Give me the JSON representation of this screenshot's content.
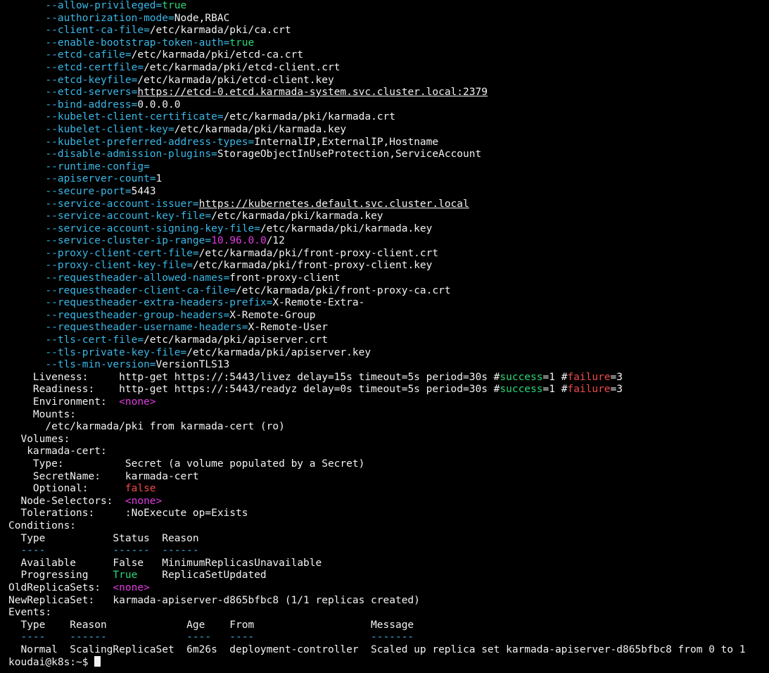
{
  "terminal": {
    "flags": [
      {
        "name": "--allow-privileged",
        "eq": "=",
        "value": "true",
        "style": "green"
      },
      {
        "name": "--authorization-mode",
        "eq": "=",
        "value": "Node,RBAC",
        "style": ""
      },
      {
        "name": "--client-ca-file",
        "eq": "=",
        "value": "/etc/karmada/pki/ca.crt",
        "style": ""
      },
      {
        "name": "--enable-bootstrap-token-auth",
        "eq": "=",
        "value": "true",
        "style": "green"
      },
      {
        "name": "--etcd-cafile",
        "eq": "=",
        "value": "/etc/karmada/pki/etcd-ca.crt",
        "style": ""
      },
      {
        "name": "--etcd-certfile",
        "eq": "=",
        "value": "/etc/karmada/pki/etcd-client.crt",
        "style": ""
      },
      {
        "name": "--etcd-keyfile",
        "eq": "=",
        "value": "/etc/karmada/pki/etcd-client.key",
        "style": ""
      },
      {
        "name": "--etcd-servers",
        "eq": "=",
        "value": "https://etcd-0.etcd.karmada-system.svc.cluster.local:2379",
        "style": "url"
      },
      {
        "name": "--bind-address",
        "eq": "=",
        "value": "0.0.0.0",
        "style": ""
      },
      {
        "name": "--kubelet-client-certificate",
        "eq": "=",
        "value": "/etc/karmada/pki/karmada.crt",
        "style": ""
      },
      {
        "name": "--kubelet-client-key",
        "eq": "=",
        "value": "/etc/karmada/pki/karmada.key",
        "style": ""
      },
      {
        "name": "--kubelet-preferred-address-types",
        "eq": "=",
        "value": "InternalIP,ExternalIP,Hostname",
        "style": ""
      },
      {
        "name": "--disable-admission-plugins",
        "eq": "=",
        "value": "StorageObjectInUseProtection,ServiceAccount",
        "style": ""
      },
      {
        "name": "--runtime-config",
        "eq": "=",
        "value": "",
        "style": ""
      },
      {
        "name": "--apiserver-count",
        "eq": "=",
        "value": "1",
        "style": ""
      },
      {
        "name": "--secure-port",
        "eq": "=",
        "value": "5443",
        "style": ""
      },
      {
        "name": "--service-account-issuer",
        "eq": "=",
        "value": "https://kubernetes.default.svc.cluster.local",
        "style": "url"
      },
      {
        "name": "--service-account-key-file",
        "eq": "=",
        "value": "/etc/karmada/pki/karmada.key",
        "style": ""
      },
      {
        "name": "--service-account-signing-key-file",
        "eq": "=",
        "value": "/etc/karmada/pki/karmada.key",
        "style": ""
      },
      {
        "name": "--service-cluster-ip-range",
        "eq": "=",
        "value": "10.96.0.0",
        "value2": "/12",
        "style": "magenta-ip"
      },
      {
        "name": "--proxy-client-cert-file",
        "eq": "=",
        "value": "/etc/karmada/pki/front-proxy-client.crt",
        "style": ""
      },
      {
        "name": "--proxy-client-key-file",
        "eq": "=",
        "value": "/etc/karmada/pki/front-proxy-client.key",
        "style": ""
      },
      {
        "name": "--requestheader-allowed-names",
        "eq": "=",
        "value": "front-proxy-client",
        "style": ""
      },
      {
        "name": "--requestheader-client-ca-file",
        "eq": "=",
        "value": "/etc/karmada/pki/front-proxy-ca.crt",
        "style": ""
      },
      {
        "name": "--requestheader-extra-headers-prefix",
        "eq": "=",
        "value": "X-Remote-Extra-",
        "style": ""
      },
      {
        "name": "--requestheader-group-headers",
        "eq": "=",
        "value": "X-Remote-Group",
        "style": ""
      },
      {
        "name": "--requestheader-username-headers",
        "eq": "=",
        "value": "X-Remote-User",
        "style": ""
      },
      {
        "name": "--tls-cert-file",
        "eq": "=",
        "value": "/etc/karmada/pki/apiserver.crt",
        "style": ""
      },
      {
        "name": "--tls-private-key-file",
        "eq": "=",
        "value": "/etc/karmada/pki/apiserver.key",
        "style": ""
      },
      {
        "name": "--tls-min-version",
        "eq": "=",
        "value": "VersionTLS13",
        "style": ""
      }
    ],
    "liveness": {
      "label": "    Liveness:     ",
      "pre": "http-get https://:5443/livez delay=15s timeout=5s period=30s #",
      "success_word": "success",
      "mid": "=1 #",
      "failure_word": "failure",
      "post": "=3"
    },
    "readiness": {
      "label": "    Readiness:    ",
      "pre": "http-get https://:5443/readyz delay=0s timeout=5s period=30s #",
      "success_word": "success",
      "mid": "=1 #",
      "failure_word": "failure",
      "post": "=3"
    },
    "environment": {
      "label": "    Environment:  ",
      "value": "<none>"
    },
    "mounts_label": "    Mounts:",
    "mount_line": "      /etc/karmada/pki from karmada-cert (ro)",
    "volumes_label": "  Volumes:",
    "volume_name": "   karmada-cert:",
    "volume_type": {
      "label": "    Type:          ",
      "value": "Secret (a volume populated by a Secret)"
    },
    "volume_secret": {
      "label": "    SecretName:    ",
      "value": "karmada-cert"
    },
    "volume_optional": {
      "label": "    Optional:      ",
      "value": "false"
    },
    "node_selectors": {
      "label": "  Node-Selectors:  ",
      "value": "<none>"
    },
    "tolerations": {
      "label": "  Tolerations:     ",
      "value": ":NoExecute op=Exists"
    },
    "conditions": {
      "label": "Conditions:",
      "header": "  Type           Status  Reason",
      "separator": "  ----           ------  ------",
      "rows": [
        {
          "type": "  Available      ",
          "status": "False",
          "status_style": "",
          "gap": "   ",
          "reason": "MinimumReplicasUnavailable"
        },
        {
          "type": "  Progressing    ",
          "status": "True",
          "status_style": "green",
          "gap": "    ",
          "reason": "ReplicaSetUpdated"
        }
      ]
    },
    "old_replica_sets": {
      "label": "OldReplicaSets:  ",
      "value": "<none>"
    },
    "new_replica_set": {
      "label": "NewReplicaSet:   ",
      "value": "karmada-apiserver-d865bfbc8 (1/1 replicas created)"
    },
    "events": {
      "label": "Events:",
      "header": "  Type    Reason             Age    From                   Message",
      "separator": "  ----    ------             ----   ----                   -------",
      "row": "  Normal  ScalingReplicaSet  6m26s  deployment-controller  Scaled up replica set karmada-apiserver-d865bfbc8 from 0 to 1"
    },
    "prompt": "koudai@k8s:~$ "
  }
}
